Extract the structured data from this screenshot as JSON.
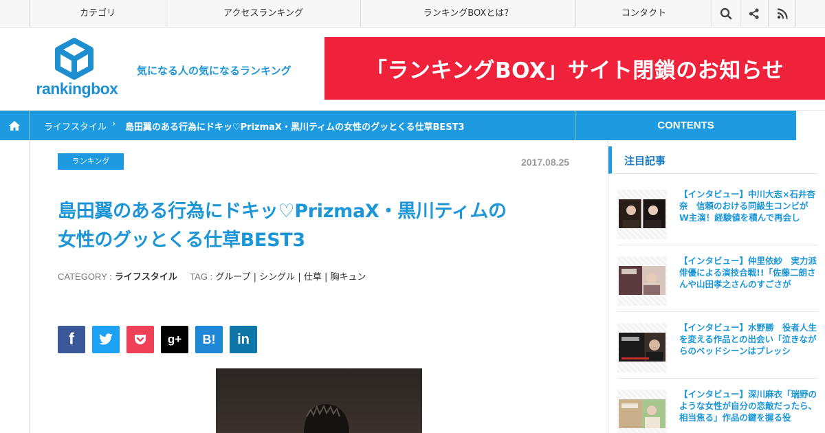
{
  "topnav": {
    "items": [
      "カテゴリ",
      "アクセスランキング",
      "ランキングBOXとは？",
      "コンタクト"
    ],
    "icons": [
      "search-icon",
      "share-icon",
      "rss-icon"
    ]
  },
  "header": {
    "logo_text": "rankingbox",
    "tagline": "気になる人の気になるランキング",
    "banner_text": "「ランキングBOX」サイト閉鎖のお知らせ",
    "banner_color": "#f0213a"
  },
  "breadcrumb": {
    "items": [
      "ライフスタイル",
      "島田翼のある行為にドキッ♡PrizmaX・黒川ティムの女性のグッとくる仕草BEST3"
    ],
    "contents_label": "CONTENTS",
    "bar_color": "#1e9be0"
  },
  "article": {
    "category_badge": "ランキング",
    "date": "2017.08.25",
    "title_line1": "島田翼のある行為にドキッ♡PrizmaX・黒川ティムの",
    "title_line2": "女性のグッとくる仕草BEST3",
    "meta": {
      "category_key": "CATEGORY :",
      "category_value": "ライフスタイル",
      "tag_key": "TAG :",
      "tags": "グループ | シングル | 仕草 | 胸キュン"
    },
    "share_buttons": [
      {
        "icon": "facebook-icon",
        "glyph": "f",
        "color": "#3b5998"
      },
      {
        "icon": "twitter-icon",
        "glyph": "",
        "color": "#1da1f2"
      },
      {
        "icon": "pocket-icon",
        "glyph": "",
        "color": "#ee4056"
      },
      {
        "icon": "googleplus-icon",
        "glyph": "g+",
        "color": "#000000"
      },
      {
        "icon": "hatena-icon",
        "glyph": "B!",
        "color": "#1e87d6"
      },
      {
        "icon": "linkedin-icon",
        "glyph": "in",
        "color": "#0e76a8"
      }
    ]
  },
  "sidebar": {
    "heading": "注目記事",
    "items": [
      {
        "text": "【インタビュー】中川大志×石井杏奈　信頼のおける同級生コンビがW主演！経験値を積んで再会し"
      },
      {
        "text": "【インタビュー】仲里依紗　実力派俳優による演技合戦!!「佐藤二朗さんや山田孝之さんのすごさが"
      },
      {
        "text": "【インタビュー】水野勝　役者人生を変える作品との出会い「泣きながらのベッドシーンはプレッシ"
      },
      {
        "text": "【インタビュー】深川麻衣「瑞野のような女性が自分の恋敵だったら、相当焦る」作品の鍵を握る役"
      }
    ]
  }
}
